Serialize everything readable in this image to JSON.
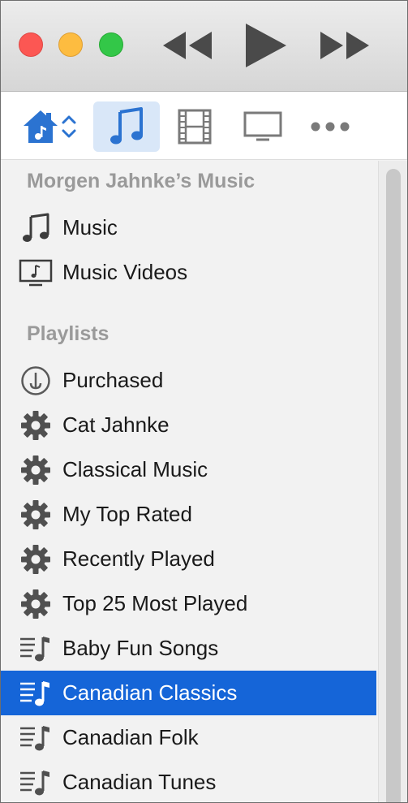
{
  "sidebar": {
    "library_header": "Morgen Jahnke’s Music",
    "library_items": [
      {
        "label": "Music",
        "icon": "music-note-icon"
      },
      {
        "label": "Music Videos",
        "icon": "music-video-icon"
      }
    ],
    "playlists_header": "Playlists",
    "playlists": [
      {
        "label": "Purchased",
        "icon": "purchased-icon",
        "selected": false
      },
      {
        "label": "Cat Jahnke",
        "icon": "smart-playlist-gear-icon",
        "selected": false
      },
      {
        "label": "Classical Music",
        "icon": "smart-playlist-gear-icon",
        "selected": false
      },
      {
        "label": "My Top Rated",
        "icon": "smart-playlist-gear-icon",
        "selected": false
      },
      {
        "label": "Recently Played",
        "icon": "smart-playlist-gear-icon",
        "selected": false
      },
      {
        "label": "Top 25 Most Played",
        "icon": "smart-playlist-gear-icon",
        "selected": false
      },
      {
        "label": "Baby Fun Songs",
        "icon": "playlist-icon",
        "selected": false
      },
      {
        "label": "Canadian Classics",
        "icon": "playlist-icon",
        "selected": true
      },
      {
        "label": "Canadian Folk",
        "icon": "playlist-icon",
        "selected": false
      },
      {
        "label": "Canadian Tunes",
        "icon": "playlist-icon",
        "selected": false
      }
    ]
  },
  "toolbar": {
    "items": [
      "home-icon",
      "music-note-icon",
      "film-strip-icon",
      "tv-icon",
      "more-icon"
    ],
    "active": "music-note-icon"
  },
  "colors": {
    "selection": "#1565d8",
    "toolbar_active_bg": "#d9e7f8",
    "accent_blue": "#2b73d1"
  }
}
